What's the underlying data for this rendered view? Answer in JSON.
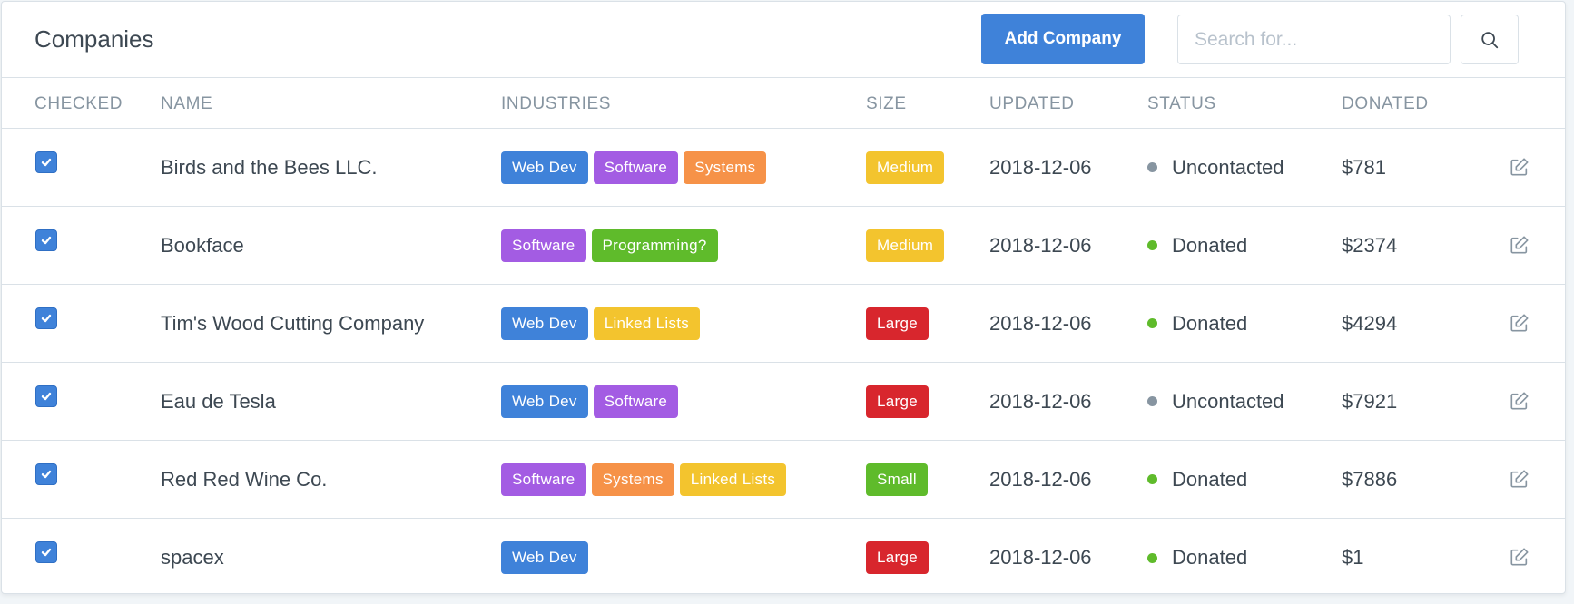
{
  "header": {
    "title": "Companies",
    "add_button_label": "Add Company",
    "search_placeholder": "Search for..."
  },
  "columns": [
    "CHECKED",
    "NAME",
    "INDUSTRIES",
    "SIZE",
    "UPDATED",
    "STATUS",
    "DONATED"
  ],
  "colors": {
    "Web Dev": "#3f82d9",
    "Software": "#a35ce3",
    "Systems": "#f69248",
    "Programming?": "#5fbb2b",
    "Linked Lists": "#f3c42e",
    "Medium": "#f3c42e",
    "Large": "#d8262d",
    "Small": "#5fbb2b",
    "Uncontacted": "#8795a1",
    "Donated": "#5fbb2b"
  },
  "rows": [
    {
      "checked": true,
      "name": "Birds and the Bees LLC.",
      "industries": [
        "Web Dev",
        "Software",
        "Systems"
      ],
      "size": "Medium",
      "updated": "2018-12-06",
      "status": "Uncontacted",
      "donated": "$781"
    },
    {
      "checked": true,
      "name": "Bookface",
      "industries": [
        "Software",
        "Programming?"
      ],
      "size": "Medium",
      "updated": "2018-12-06",
      "status": "Donated",
      "donated": "$2374"
    },
    {
      "checked": true,
      "name": "Tim's Wood Cutting Company",
      "industries": [
        "Web Dev",
        "Linked Lists"
      ],
      "size": "Large",
      "updated": "2018-12-06",
      "status": "Donated",
      "donated": "$4294"
    },
    {
      "checked": true,
      "name": "Eau de Tesla",
      "industries": [
        "Web Dev",
        "Software"
      ],
      "size": "Large",
      "updated": "2018-12-06",
      "status": "Uncontacted",
      "donated": "$7921"
    },
    {
      "checked": true,
      "name": "Red Red Wine Co.",
      "industries": [
        "Software",
        "Systems",
        "Linked Lists"
      ],
      "size": "Small",
      "updated": "2018-12-06",
      "status": "Donated",
      "donated": "$7886"
    },
    {
      "checked": true,
      "name": "spacex",
      "industries": [
        "Web Dev"
      ],
      "size": "Large",
      "updated": "2018-12-06",
      "status": "Donated",
      "donated": "$1"
    }
  ]
}
